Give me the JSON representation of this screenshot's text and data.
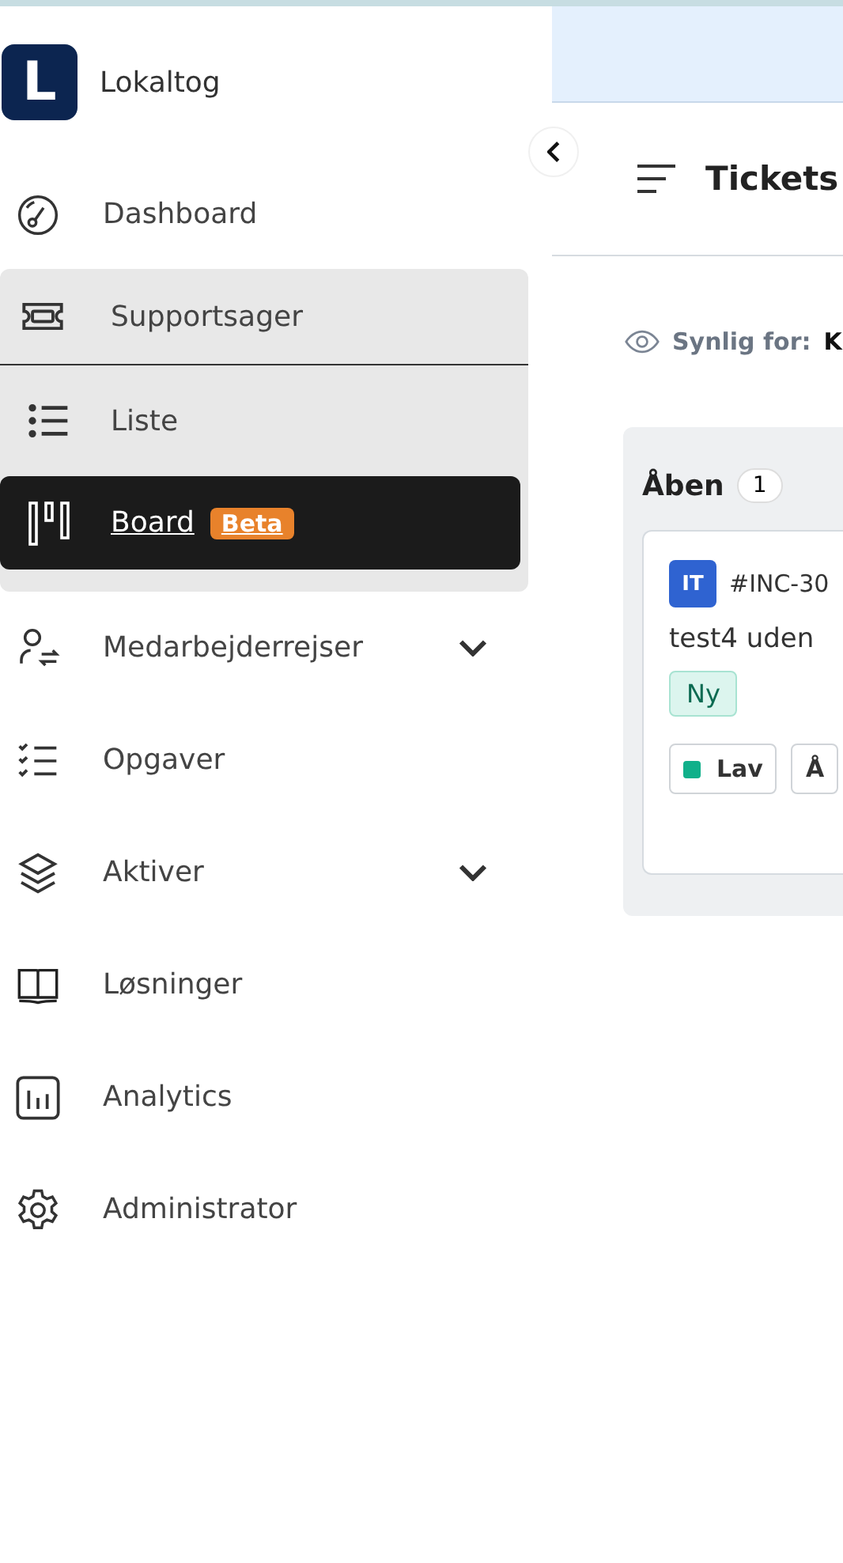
{
  "app": {
    "logo_letter": "L",
    "name": "Lokaltog"
  },
  "sidebar": {
    "items": [
      {
        "label": "Dashboard",
        "selected": false
      },
      {
        "label": "Supportsager",
        "selected": false,
        "expanded": true,
        "children": [
          {
            "label": "Liste",
            "selected": false
          },
          {
            "label": "Board",
            "selected": true,
            "badge": "Beta"
          }
        ]
      },
      {
        "label": "Medarbejderrejser",
        "selected": false,
        "expanded": false
      },
      {
        "label": "Opgaver",
        "selected": false
      },
      {
        "label": "Aktiver",
        "selected": false,
        "expanded": false
      },
      {
        "label": "Løsninger",
        "selected": false
      },
      {
        "label": "Analytics",
        "selected": false
      },
      {
        "label": "Administrator",
        "selected": false
      }
    ]
  },
  "header": {
    "title": "Tickets"
  },
  "visibility": {
    "label": "Synlig for:",
    "value": "K"
  },
  "board": {
    "columns": [
      {
        "title": "Åben",
        "count": "1",
        "cards": [
          {
            "team": "IT",
            "id": "#INC-30",
            "title": "test4 uden",
            "status": "Ny",
            "chips": [
              {
                "label": "Lav",
                "color": "#10b08a"
              },
              {
                "label": "Å"
              }
            ]
          }
        ]
      }
    ]
  }
}
